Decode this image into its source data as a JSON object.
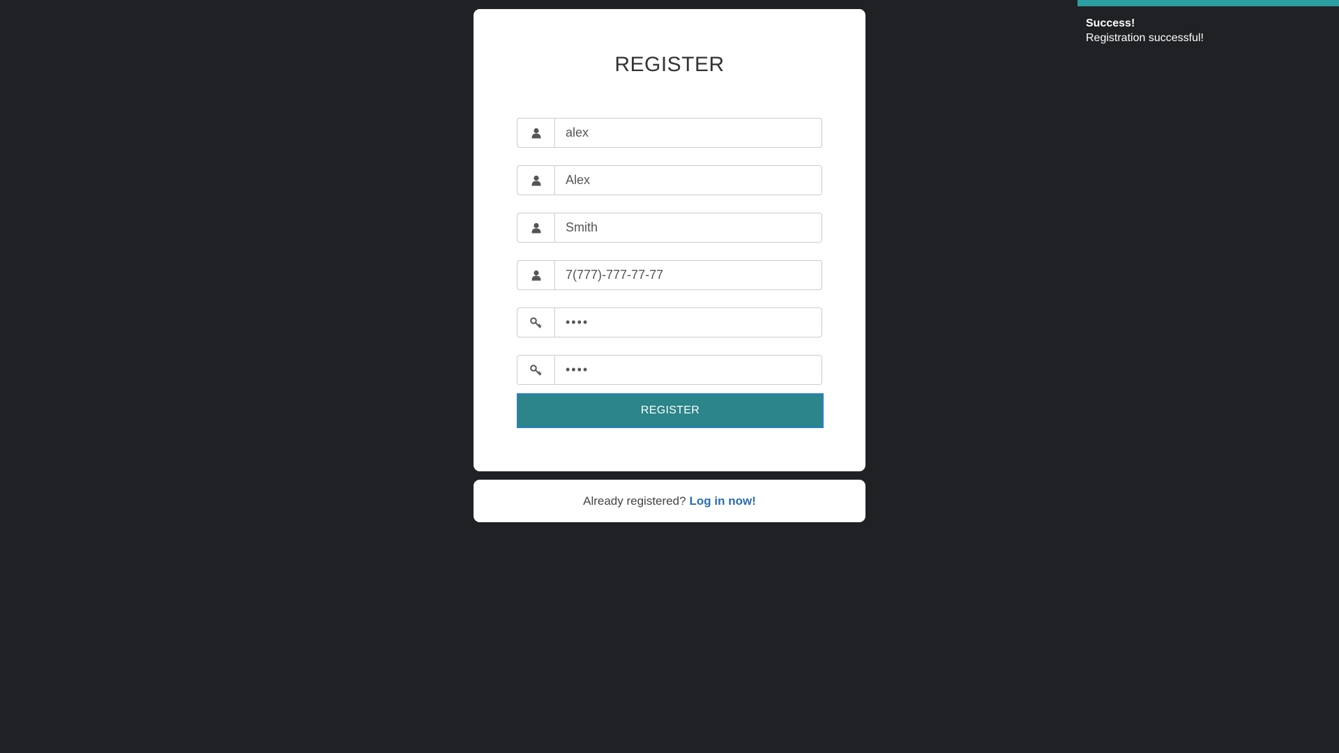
{
  "register_form": {
    "title": "REGISTER",
    "fields": [
      {
        "name": "username",
        "icon": "user-icon",
        "type": "text",
        "value": "alex"
      },
      {
        "name": "first_name",
        "icon": "user-icon",
        "type": "text",
        "value": "Alex"
      },
      {
        "name": "last_name",
        "icon": "user-icon",
        "type": "text",
        "value": "Smith"
      },
      {
        "name": "phone",
        "icon": "user-icon",
        "type": "text",
        "value": "7(777)-777-77-77"
      },
      {
        "name": "password",
        "icon": "key-icon",
        "type": "password",
        "value": "••••"
      },
      {
        "name": "password_confirm",
        "icon": "key-icon",
        "type": "password",
        "value": "••••"
      }
    ],
    "submit_label": "REGISTER"
  },
  "login_prompt": {
    "text": "Already registered?",
    "link_label": "Log in now!"
  },
  "toast": {
    "title": "Success!",
    "message": "Registration successful!"
  },
  "colors": {
    "background": "#202124",
    "accent": "#2b8589",
    "toast_bar": "#2b9ea1",
    "link": "#2a6db0"
  }
}
